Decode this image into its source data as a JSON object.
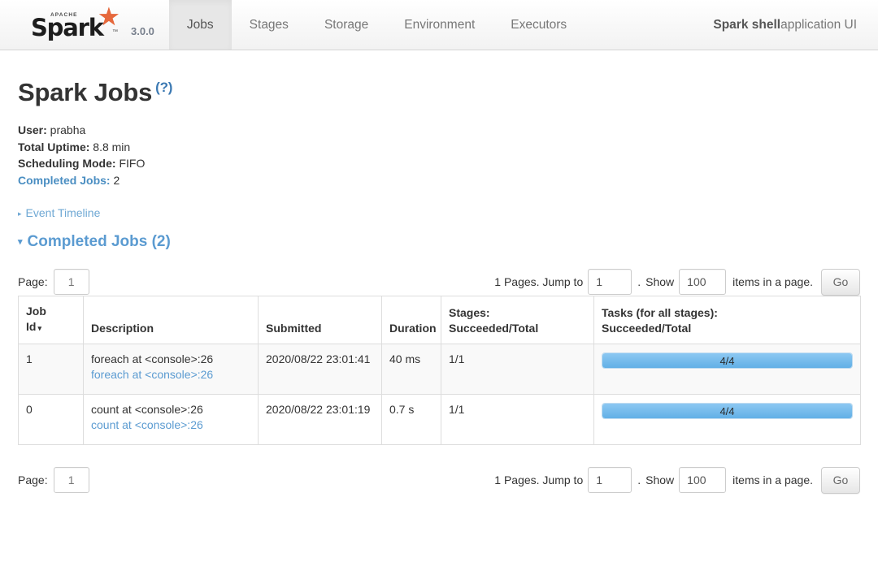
{
  "navbar": {
    "logo": {
      "apache": "APACHE",
      "name": "Spark",
      "tm": "™",
      "star": "★"
    },
    "version": "3.0.0",
    "tabs": [
      {
        "label": "Jobs",
        "active": true
      },
      {
        "label": "Stages",
        "active": false
      },
      {
        "label": "Storage",
        "active": false
      },
      {
        "label": "Environment",
        "active": false
      },
      {
        "label": "Executors",
        "active": false
      }
    ],
    "app_name": "Spark shell",
    "app_suffix": " application UI"
  },
  "page": {
    "title": "Spark Jobs",
    "help_link": "(?)"
  },
  "summary": {
    "user_label": "User:",
    "user_value": " prabha",
    "uptime_label": "Total Uptime:",
    "uptime_value": " 8.8 min",
    "scheduling_label": "Scheduling Mode:",
    "scheduling_value": " FIFO",
    "completed_label": "Completed Jobs:",
    "completed_value": " 2"
  },
  "toggles": {
    "event_timeline": "Event Timeline",
    "event_timeline_arrow": "▸",
    "completed_jobs": "Completed Jobs (2)",
    "completed_jobs_arrow": "▾"
  },
  "pager": {
    "page_label": "Page:",
    "page_value": "1",
    "pages_text": "1 Pages. Jump to",
    "jump_value": "1",
    "dot": ".",
    "show_label": "Show",
    "show_value": "100",
    "items_text": "items in a page.",
    "go_label": "Go"
  },
  "table": {
    "headers": {
      "job_id_l1": "Job",
      "job_id_l2": "Id",
      "sort_caret": "▾",
      "description": "Description",
      "submitted": "Submitted",
      "duration": "Duration",
      "stages_l1": "Stages:",
      "stages_l2": "Succeeded/Total",
      "tasks_l1": "Tasks (for all stages):",
      "tasks_l2": "Succeeded/Total"
    },
    "rows": [
      {
        "job_id": "1",
        "desc_main": "foreach at <console>:26",
        "desc_link": "foreach at <console>:26",
        "submitted_date": "2020/08/22",
        "submitted_time": "23:01:41",
        "duration": "40 ms",
        "stages": "1/1",
        "tasks_text": "4/4",
        "tasks_percent": 100
      },
      {
        "job_id": "0",
        "desc_main": "count at <console>:26",
        "desc_link": "count at <console>:26",
        "submitted_date": "2020/08/22",
        "submitted_time": "23:01:19",
        "duration": "0.7 s",
        "stages": "1/1",
        "tasks_text": "4/4",
        "tasks_percent": 100
      }
    ]
  },
  "colors": {
    "link_blue": "#5b9bd1",
    "accent_orange": "#e6683c",
    "progress_blue": "#62b0e6",
    "active_tab_bg": "#e7e7e7"
  }
}
